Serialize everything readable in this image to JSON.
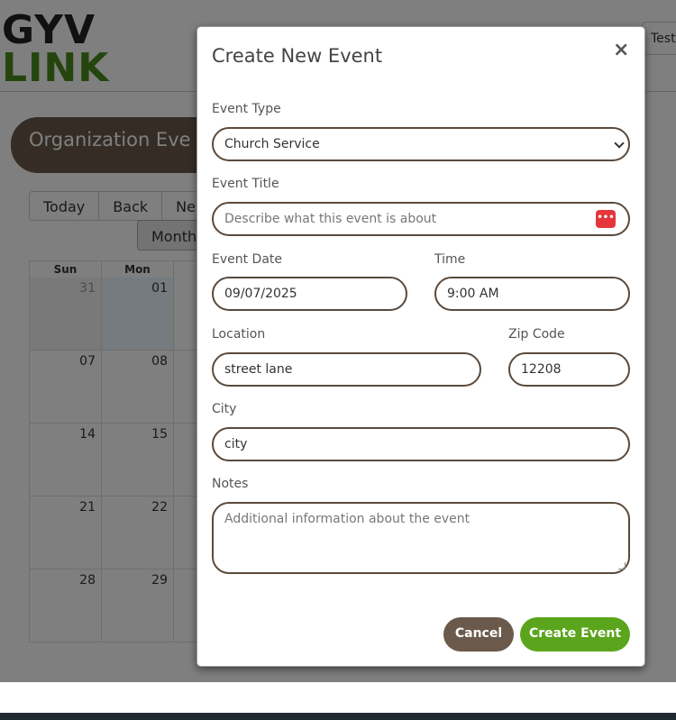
{
  "logo": {
    "line1": "GYV",
    "line2": "LINK"
  },
  "header": {
    "user_label": "Test"
  },
  "banner": {
    "title": "Organization Eve"
  },
  "calendar_toolbar": {
    "today": "Today",
    "back": "Back",
    "next": "Ne",
    "view": "Month"
  },
  "calendar": {
    "days": [
      "Sun",
      "Mon",
      ""
    ],
    "rows": [
      [
        "31",
        "01",
        ""
      ],
      [
        "07",
        "08",
        ""
      ],
      [
        "14",
        "15",
        ""
      ],
      [
        "21",
        "22",
        ""
      ],
      [
        "28",
        "29",
        ""
      ]
    ]
  },
  "modal": {
    "title": "Create New Event",
    "close_icon": "×",
    "event_type": {
      "label": "Event Type",
      "value": "Church Service"
    },
    "event_title": {
      "label": "Event Title",
      "placeholder": "Describe what this event is about",
      "icon": "password-manager-icon"
    },
    "event_date": {
      "label": "Event Date",
      "value": "09/07/2025"
    },
    "time": {
      "label": "Time",
      "value": "9:00 AM"
    },
    "location": {
      "label": "Location",
      "value": "street lane"
    },
    "zip": {
      "label": "Zip Code",
      "value": "12208"
    },
    "city": {
      "label": "City",
      "value": "city"
    },
    "notes": {
      "label": "Notes",
      "placeholder": "Additional information about the event"
    },
    "cancel_label": "Cancel",
    "create_label": "Create Event"
  },
  "colors": {
    "brand_brown": "#6b5a4b",
    "brand_green": "#5ba51c",
    "overlay": "rgba(0,0,0,0.5)"
  }
}
